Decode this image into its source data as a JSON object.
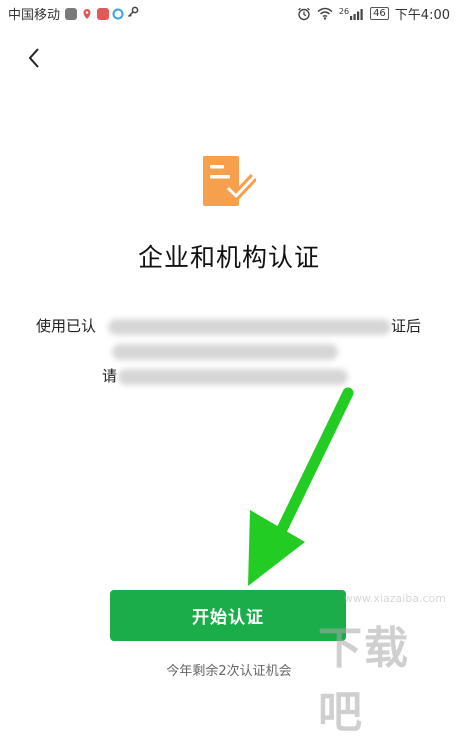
{
  "status_bar": {
    "carrier": "中国移动",
    "network_type": "26",
    "battery": "46",
    "time": "下午4:00",
    "app_icon_colors": [
      "#7a7a7a",
      "#e5534b",
      "#e05a5a",
      "#3aa0e0"
    ]
  },
  "header": {
    "back_icon": "chevron-left-icon"
  },
  "main": {
    "icon": "certificate-document-icon",
    "icon_color": "#f6a04d",
    "title": "企业和机构认证",
    "description_lines": [
      {
        "start": "使用已认",
        "end": "证后"
      },
      {
        "start": "",
        "end": ""
      },
      {
        "start": "请",
        "end": ""
      }
    ]
  },
  "actions": {
    "start_button_label": "开始认证",
    "start_button_color": "#1aad4a",
    "remaining_text": "今年剩余2次认证机会"
  },
  "annotation": {
    "arrow_color": "#22cc22"
  },
  "watermark": {
    "logo": "下载吧",
    "site": "www.xiazaiba.com"
  }
}
